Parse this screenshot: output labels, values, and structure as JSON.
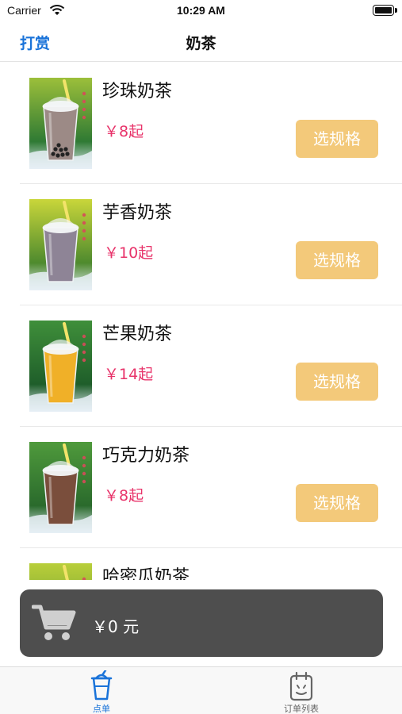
{
  "status_bar": {
    "carrier": "Carrier",
    "time": "10:29 AM"
  },
  "nav": {
    "left_action": "打赏",
    "title": "奶茶"
  },
  "products": [
    {
      "name": "珍珠奶茶",
      "price": "￥8起",
      "button": "选规格",
      "drink_color": "#9c8a86",
      "bg_top": "#9cbf3a",
      "bg_bottom": "#2f7a34",
      "boba": true
    },
    {
      "name": "芋香奶茶",
      "price": "￥10起",
      "button": "选规格",
      "drink_color": "#8e8496",
      "bg_top": "#c9d63a",
      "bg_bottom": "#4e8a2e",
      "boba": false
    },
    {
      "name": "芒果奶茶",
      "price": "￥14起",
      "button": "选规格",
      "drink_color": "#f0b028",
      "bg_top": "#3f8f3a",
      "bg_bottom": "#1f5e2a",
      "boba": false
    },
    {
      "name": "巧克力奶茶",
      "price": "￥8起",
      "button": "选规格",
      "drink_color": "#7a4e3c",
      "bg_top": "#4f9a3c",
      "bg_bottom": "#2a6a2c",
      "boba": false
    },
    {
      "name": "哈密瓜奶茶",
      "price": "",
      "button": "",
      "drink_color": "#d8d27a",
      "bg_top": "#b9cf3a",
      "bg_bottom": "#6a9a30",
      "boba": false
    }
  ],
  "cart": {
    "total": "￥0 元",
    "icon": "shopping-cart-icon"
  },
  "tabs": [
    {
      "label": "点单",
      "icon": "cup-icon",
      "active": true,
      "color": "#1a73d9"
    },
    {
      "label": "订单列表",
      "icon": "order-list-icon",
      "active": false,
      "color": "#666666"
    }
  ],
  "colors": {
    "accent": "#1a73d9",
    "price": "#e8336a",
    "button": "#f3c97a",
    "cart_bar": "#4e4e4e"
  }
}
